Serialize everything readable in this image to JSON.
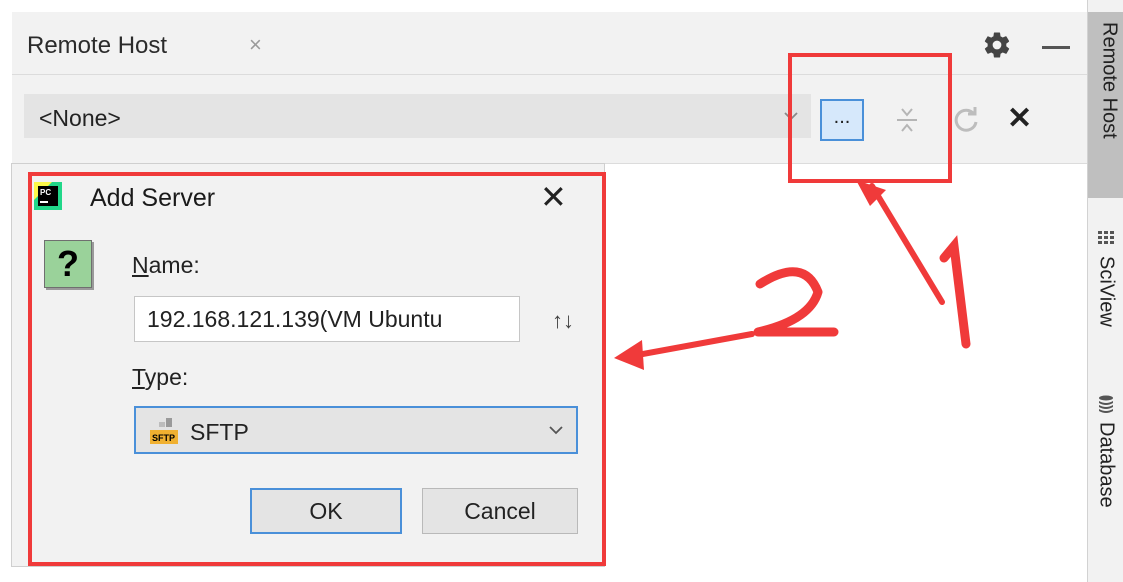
{
  "tool_window": {
    "title": "Remote Host",
    "close_glyph": "×",
    "gear_icon": "gear-icon",
    "minimize_icon": "minimize-icon"
  },
  "toolbar": {
    "host_select_value": "<None>",
    "browse_label": "...",
    "disconnect_glyph": "✕"
  },
  "side_tabs": [
    {
      "label": "Remote Host",
      "active": true
    },
    {
      "label": "SciView",
      "icon": "sciview-icon"
    },
    {
      "label": "Database",
      "icon": "database-icon"
    }
  ],
  "dialog": {
    "title": "Add Server",
    "close_glyph": "✕",
    "question_glyph": "?",
    "name_label_mnemonic": "N",
    "name_label_rest": "ame:",
    "name_value": "192.168.121.139(VM Ubuntu",
    "swap_glyph": "↑↓",
    "type_label_mnemonic": "T",
    "type_label_rest": "ype:",
    "type_value": "SFTP",
    "ok_label": "OK",
    "cancel_label": "Cancel"
  },
  "annotations": {
    "mark_color": "#f03a3a",
    "step1": "1",
    "step2": "2"
  }
}
